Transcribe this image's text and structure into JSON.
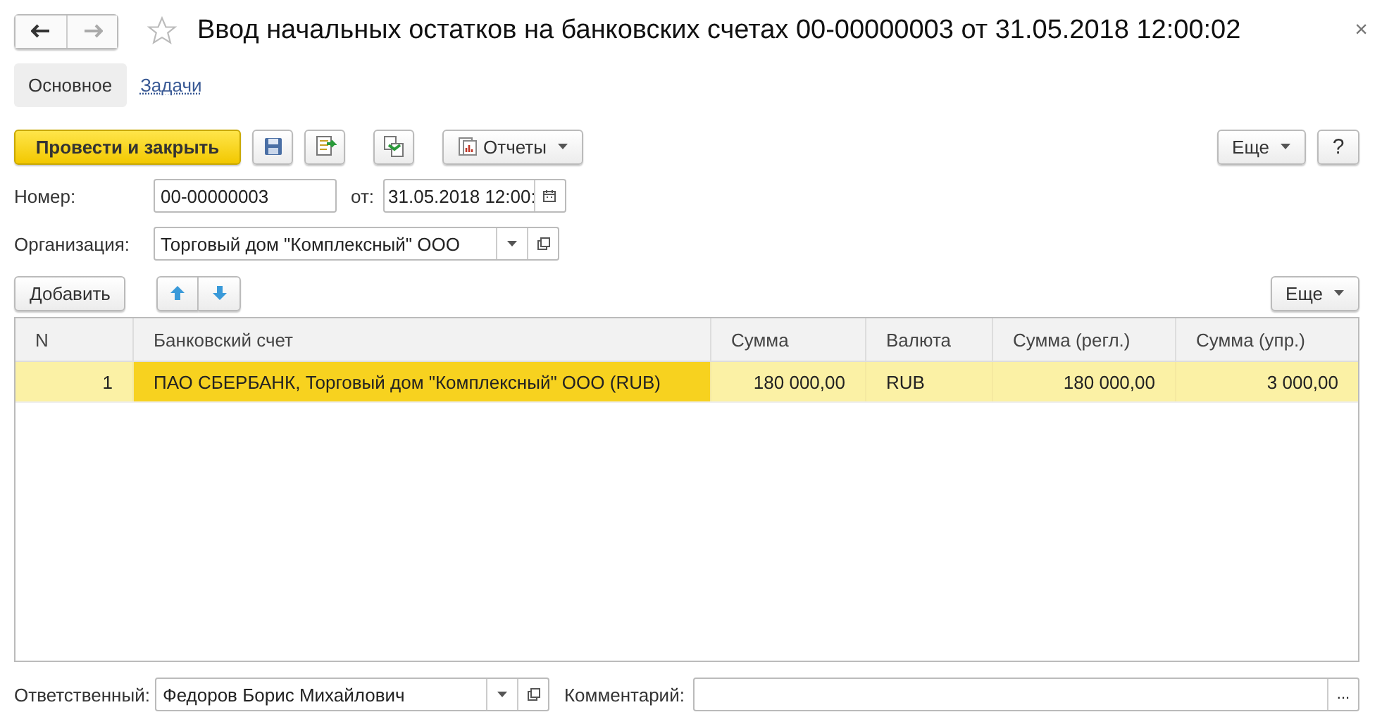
{
  "window": {
    "title": "Ввод начальных остатков на банковских счетах 00-00000003 от 31.05.2018 12:00:02",
    "favorite": false,
    "close": "×"
  },
  "tabs": [
    {
      "label": "Основное",
      "selected": true
    },
    {
      "label": "Задачи",
      "selected": false
    }
  ],
  "toolbar": {
    "post_button": "Провести и закрыть",
    "reports_button": "Отчеты",
    "more_button": "Еще",
    "help_button": "?"
  },
  "number": {
    "label": "Номер:",
    "value": "00-00000003",
    "date_label": "от:",
    "date_value": "31.05.2018 12:00:"
  },
  "organization": {
    "label": "Организация:",
    "value": "Торговый дом \"Комплексный\" ООО"
  },
  "table_toolbar": {
    "add_button": "Добавить",
    "more_button": "Еще"
  },
  "table": {
    "columns": [
      {
        "title": "N",
        "kind": "number"
      },
      {
        "title": "Банковский счет",
        "kind": "text"
      },
      {
        "title": "Сумма",
        "kind": "number"
      },
      {
        "title": "Валюта",
        "kind": "text"
      },
      {
        "title": "Сумма (регл.)",
        "kind": "number"
      },
      {
        "title": "Сумма (упр.)",
        "kind": "number"
      }
    ],
    "rows": [
      {
        "selected": true,
        "cells": [
          {
            "text": "1",
            "selected": false
          },
          {
            "text": "ПАО СБЕРБАНК, Торговый дом \"Комплексный\" ООО (RUB)",
            "selected": true
          },
          {
            "text": "180 000,00",
            "selected": false
          },
          {
            "text": "RUB",
            "selected": false
          },
          {
            "text": "180 000,00",
            "selected": false
          },
          {
            "text": "3 000,00",
            "selected": false
          }
        ]
      }
    ]
  },
  "footer": {
    "responsible_label": "Ответственный:",
    "responsible_value": "Федоров Борис Михайлович",
    "comment_label": "Комментарий:",
    "comment_button": "..."
  }
}
